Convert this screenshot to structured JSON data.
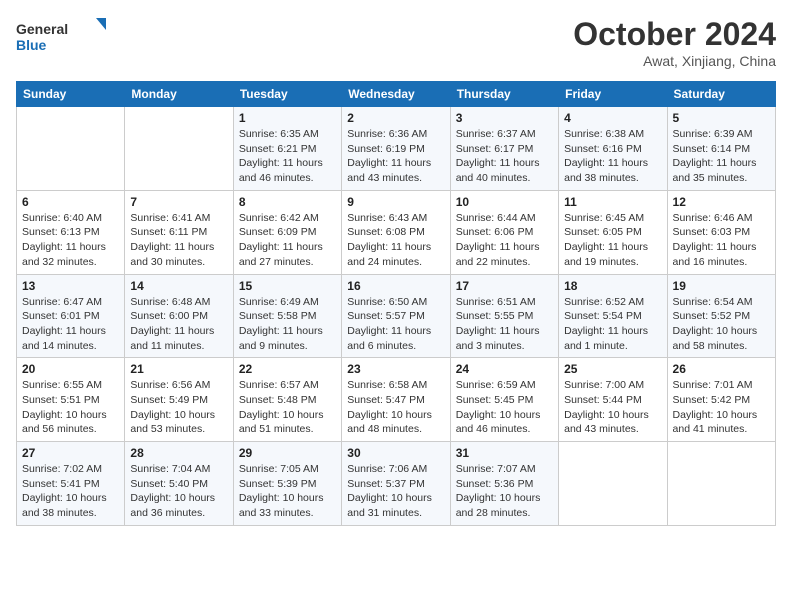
{
  "header": {
    "logo_general": "General",
    "logo_blue": "Blue",
    "month": "October 2024",
    "location": "Awat, Xinjiang, China"
  },
  "days_of_week": [
    "Sunday",
    "Monday",
    "Tuesday",
    "Wednesday",
    "Thursday",
    "Friday",
    "Saturday"
  ],
  "weeks": [
    [
      {
        "day": "",
        "sunrise": "",
        "sunset": "",
        "daylight": ""
      },
      {
        "day": "",
        "sunrise": "",
        "sunset": "",
        "daylight": ""
      },
      {
        "day": "1",
        "sunrise": "Sunrise: 6:35 AM",
        "sunset": "Sunset: 6:21 PM",
        "daylight": "Daylight: 11 hours and 46 minutes."
      },
      {
        "day": "2",
        "sunrise": "Sunrise: 6:36 AM",
        "sunset": "Sunset: 6:19 PM",
        "daylight": "Daylight: 11 hours and 43 minutes."
      },
      {
        "day": "3",
        "sunrise": "Sunrise: 6:37 AM",
        "sunset": "Sunset: 6:17 PM",
        "daylight": "Daylight: 11 hours and 40 minutes."
      },
      {
        "day": "4",
        "sunrise": "Sunrise: 6:38 AM",
        "sunset": "Sunset: 6:16 PM",
        "daylight": "Daylight: 11 hours and 38 minutes."
      },
      {
        "day": "5",
        "sunrise": "Sunrise: 6:39 AM",
        "sunset": "Sunset: 6:14 PM",
        "daylight": "Daylight: 11 hours and 35 minutes."
      }
    ],
    [
      {
        "day": "6",
        "sunrise": "Sunrise: 6:40 AM",
        "sunset": "Sunset: 6:13 PM",
        "daylight": "Daylight: 11 hours and 32 minutes."
      },
      {
        "day": "7",
        "sunrise": "Sunrise: 6:41 AM",
        "sunset": "Sunset: 6:11 PM",
        "daylight": "Daylight: 11 hours and 30 minutes."
      },
      {
        "day": "8",
        "sunrise": "Sunrise: 6:42 AM",
        "sunset": "Sunset: 6:09 PM",
        "daylight": "Daylight: 11 hours and 27 minutes."
      },
      {
        "day": "9",
        "sunrise": "Sunrise: 6:43 AM",
        "sunset": "Sunset: 6:08 PM",
        "daylight": "Daylight: 11 hours and 24 minutes."
      },
      {
        "day": "10",
        "sunrise": "Sunrise: 6:44 AM",
        "sunset": "Sunset: 6:06 PM",
        "daylight": "Daylight: 11 hours and 22 minutes."
      },
      {
        "day": "11",
        "sunrise": "Sunrise: 6:45 AM",
        "sunset": "Sunset: 6:05 PM",
        "daylight": "Daylight: 11 hours and 19 minutes."
      },
      {
        "day": "12",
        "sunrise": "Sunrise: 6:46 AM",
        "sunset": "Sunset: 6:03 PM",
        "daylight": "Daylight: 11 hours and 16 minutes."
      }
    ],
    [
      {
        "day": "13",
        "sunrise": "Sunrise: 6:47 AM",
        "sunset": "Sunset: 6:01 PM",
        "daylight": "Daylight: 11 hours and 14 minutes."
      },
      {
        "day": "14",
        "sunrise": "Sunrise: 6:48 AM",
        "sunset": "Sunset: 6:00 PM",
        "daylight": "Daylight: 11 hours and 11 minutes."
      },
      {
        "day": "15",
        "sunrise": "Sunrise: 6:49 AM",
        "sunset": "Sunset: 5:58 PM",
        "daylight": "Daylight: 11 hours and 9 minutes."
      },
      {
        "day": "16",
        "sunrise": "Sunrise: 6:50 AM",
        "sunset": "Sunset: 5:57 PM",
        "daylight": "Daylight: 11 hours and 6 minutes."
      },
      {
        "day": "17",
        "sunrise": "Sunrise: 6:51 AM",
        "sunset": "Sunset: 5:55 PM",
        "daylight": "Daylight: 11 hours and 3 minutes."
      },
      {
        "day": "18",
        "sunrise": "Sunrise: 6:52 AM",
        "sunset": "Sunset: 5:54 PM",
        "daylight": "Daylight: 11 hours and 1 minute."
      },
      {
        "day": "19",
        "sunrise": "Sunrise: 6:54 AM",
        "sunset": "Sunset: 5:52 PM",
        "daylight": "Daylight: 10 hours and 58 minutes."
      }
    ],
    [
      {
        "day": "20",
        "sunrise": "Sunrise: 6:55 AM",
        "sunset": "Sunset: 5:51 PM",
        "daylight": "Daylight: 10 hours and 56 minutes."
      },
      {
        "day": "21",
        "sunrise": "Sunrise: 6:56 AM",
        "sunset": "Sunset: 5:49 PM",
        "daylight": "Daylight: 10 hours and 53 minutes."
      },
      {
        "day": "22",
        "sunrise": "Sunrise: 6:57 AM",
        "sunset": "Sunset: 5:48 PM",
        "daylight": "Daylight: 10 hours and 51 minutes."
      },
      {
        "day": "23",
        "sunrise": "Sunrise: 6:58 AM",
        "sunset": "Sunset: 5:47 PM",
        "daylight": "Daylight: 10 hours and 48 minutes."
      },
      {
        "day": "24",
        "sunrise": "Sunrise: 6:59 AM",
        "sunset": "Sunset: 5:45 PM",
        "daylight": "Daylight: 10 hours and 46 minutes."
      },
      {
        "day": "25",
        "sunrise": "Sunrise: 7:00 AM",
        "sunset": "Sunset: 5:44 PM",
        "daylight": "Daylight: 10 hours and 43 minutes."
      },
      {
        "day": "26",
        "sunrise": "Sunrise: 7:01 AM",
        "sunset": "Sunset: 5:42 PM",
        "daylight": "Daylight: 10 hours and 41 minutes."
      }
    ],
    [
      {
        "day": "27",
        "sunrise": "Sunrise: 7:02 AM",
        "sunset": "Sunset: 5:41 PM",
        "daylight": "Daylight: 10 hours and 38 minutes."
      },
      {
        "day": "28",
        "sunrise": "Sunrise: 7:04 AM",
        "sunset": "Sunset: 5:40 PM",
        "daylight": "Daylight: 10 hours and 36 minutes."
      },
      {
        "day": "29",
        "sunrise": "Sunrise: 7:05 AM",
        "sunset": "Sunset: 5:39 PM",
        "daylight": "Daylight: 10 hours and 33 minutes."
      },
      {
        "day": "30",
        "sunrise": "Sunrise: 7:06 AM",
        "sunset": "Sunset: 5:37 PM",
        "daylight": "Daylight: 10 hours and 31 minutes."
      },
      {
        "day": "31",
        "sunrise": "Sunrise: 7:07 AM",
        "sunset": "Sunset: 5:36 PM",
        "daylight": "Daylight: 10 hours and 28 minutes."
      },
      {
        "day": "",
        "sunrise": "",
        "sunset": "",
        "daylight": ""
      },
      {
        "day": "",
        "sunrise": "",
        "sunset": "",
        "daylight": ""
      }
    ]
  ]
}
